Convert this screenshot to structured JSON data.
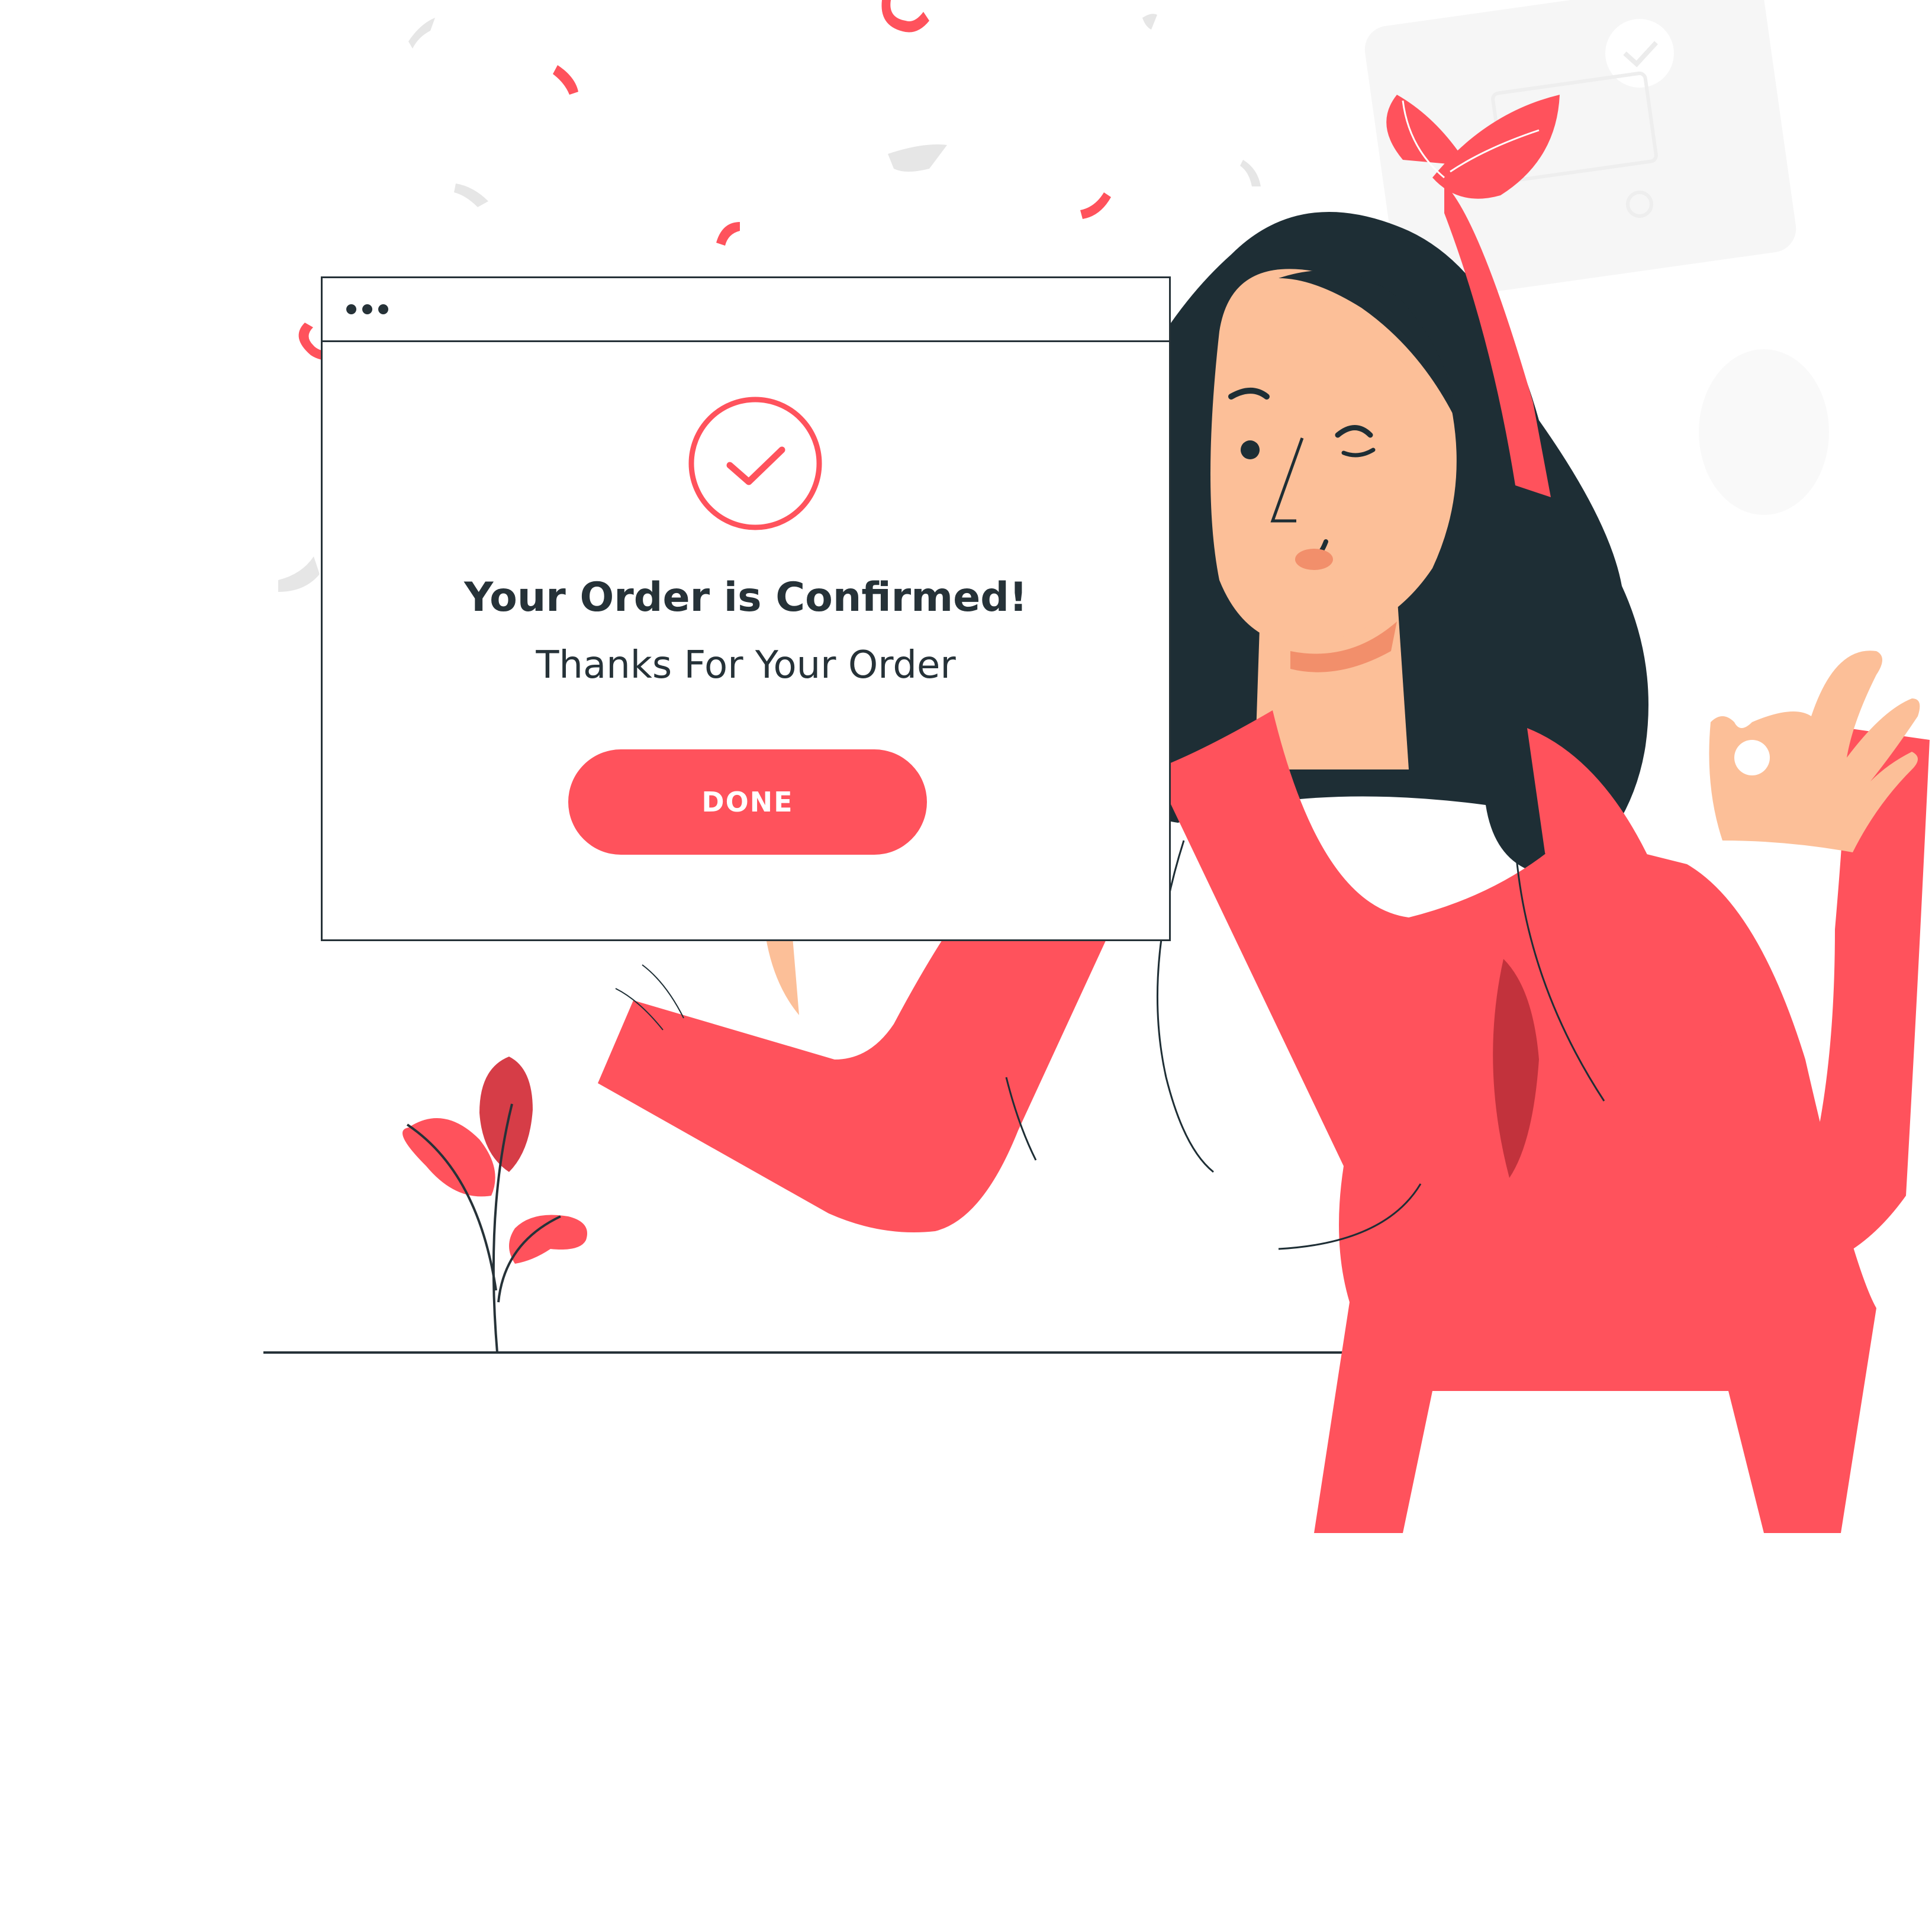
{
  "dialog": {
    "title": "Your Order is Confirmed!",
    "subtitle": "Thanks For Your Order",
    "done_label": "DONE"
  },
  "icons": {
    "window_controls": "three-dots-icon",
    "status": "check-circle-icon"
  },
  "colors": {
    "accent": "#ff525c",
    "dark": "#263238",
    "hair": "#1e2e35",
    "skin": "#fcbf98",
    "shirt": "#ff525c",
    "shirt_shadow": "#c2323c",
    "leaf_dark": "#d63d47",
    "confetti_gray": "#e6e6e6"
  }
}
